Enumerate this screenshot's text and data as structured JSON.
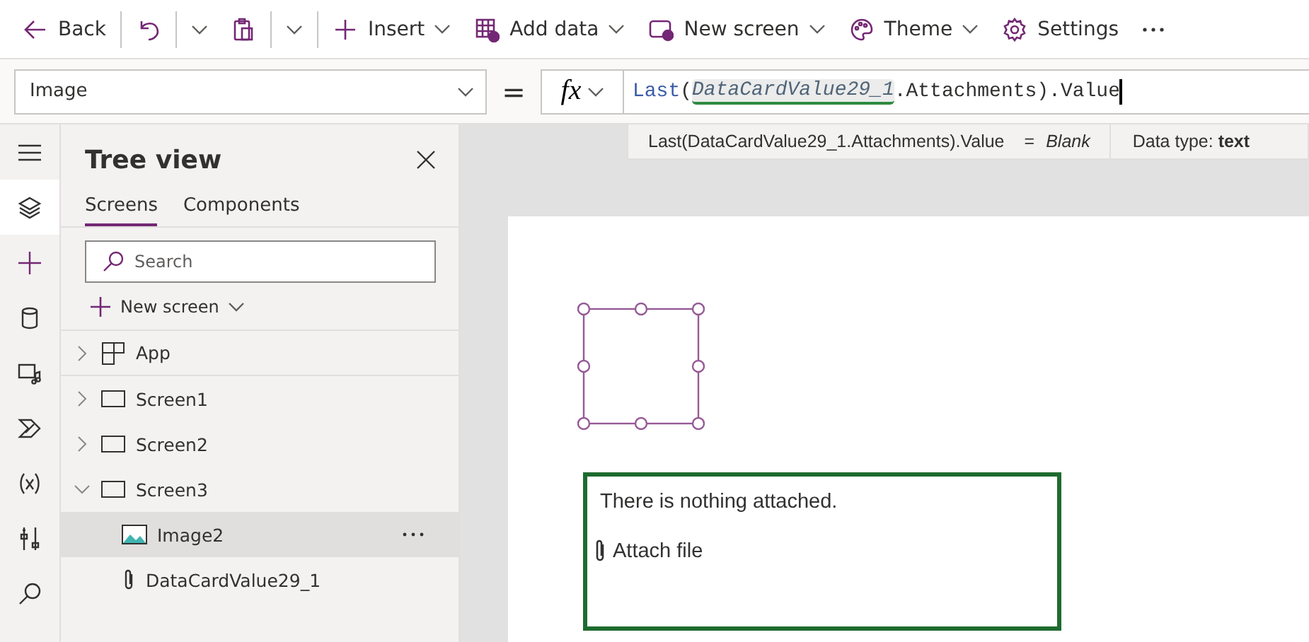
{
  "toolbar": [
    {
      "kind": "back",
      "label": "Back",
      "caret": false,
      "separator_after": true
    },
    {
      "kind": "undo",
      "caret": true,
      "separator_after": false
    },
    {
      "kind": "paste",
      "caret": true,
      "separator_after": true
    },
    {
      "kind": "insert",
      "label": "Insert",
      "caret": true,
      "separator_after": false
    },
    {
      "kind": "add_data",
      "label": "Add data",
      "caret": true,
      "separator_after": false
    },
    {
      "kind": "new_screen",
      "label": "New screen",
      "caret": true,
      "separator_after": false
    },
    {
      "kind": "theme",
      "label": "Theme",
      "caret": true,
      "separator_after": false
    },
    {
      "kind": "settings",
      "label": "Settings",
      "caret": false,
      "separator_after": false
    },
    {
      "kind": "more",
      "caret": false,
      "separator_after": false
    }
  ],
  "formula_bar": {
    "property": "Image",
    "equals": "=",
    "function_label": "fx",
    "tokens": [
      {
        "kind": "function",
        "text": "Last"
      },
      {
        "kind": "plain",
        "text": "("
      },
      {
        "kind": "reference",
        "text": "DataCardValue29_1"
      },
      {
        "kind": "plain",
        "text": ".Attachments).Value"
      }
    ]
  },
  "result_popup": {
    "expression": "Last(DataCardValue29_1.Attachments).Value",
    "equals": "=",
    "result": "Blank",
    "data_type": "Data type: **text**"
  },
  "rail": [
    {
      "kind": "menu",
      "selected": false
    },
    {
      "kind": "layers",
      "selected": true
    },
    {
      "kind": "insert",
      "selected": false
    },
    {
      "kind": "data",
      "selected": false
    },
    {
      "kind": "media",
      "selected": false
    },
    {
      "kind": "automate",
      "selected": false
    },
    {
      "kind": "variables",
      "selected": false
    },
    {
      "kind": "tools",
      "selected": false
    },
    {
      "kind": "search",
      "selected": false
    }
  ],
  "tree_view": {
    "title": "Tree view",
    "tabs": [
      {
        "label": "Screens",
        "selected": true
      },
      {
        "label": "Components",
        "selected": false
      }
    ],
    "search": {
      "placeholder": "Search"
    },
    "new_screen": "New screen",
    "items": [
      {
        "kind": "app",
        "label": "App",
        "expanded": false,
        "selected": false
      },
      {
        "kind": "screen",
        "label": "Screen1",
        "expanded": false,
        "selected": false
      },
      {
        "kind": "screen",
        "label": "Screen2",
        "expanded": false,
        "selected": false
      },
      {
        "kind": "screen",
        "label": "Screen3",
        "expanded": true,
        "selected": false,
        "children": [
          {
            "kind": "image",
            "label": "Image2",
            "selected": true
          },
          {
            "kind": "attachments",
            "label": "DataCardValue29_1",
            "selected": false
          }
        ]
      }
    ]
  },
  "canvas": {
    "image_control": {
      "selected": true
    },
    "attachments": {
      "message": "There is nothing attached.",
      "action": "Attach file"
    }
  }
}
